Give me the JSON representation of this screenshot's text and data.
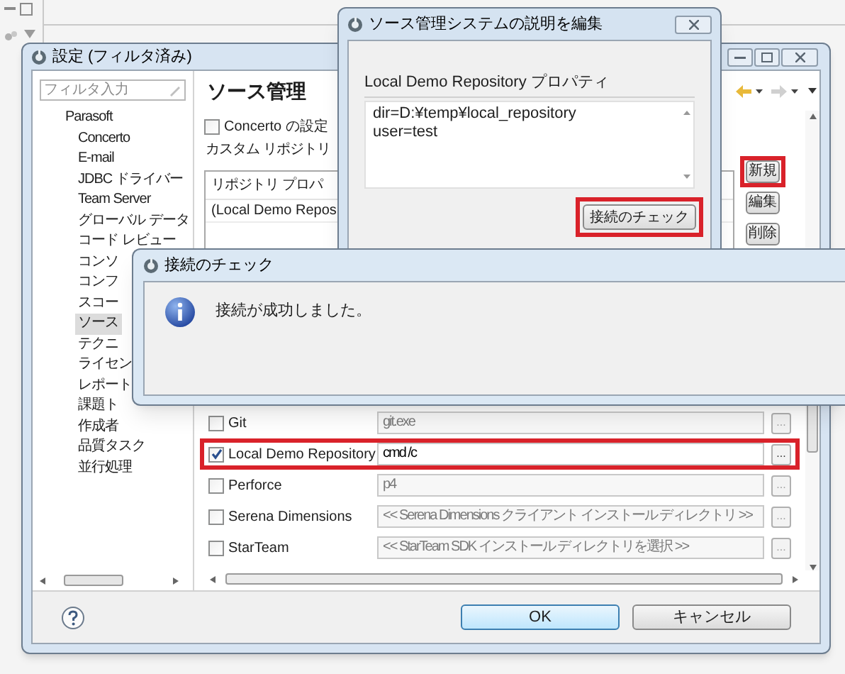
{
  "preferences": {
    "title": "設定 (フィルタ済み)",
    "filter_placeholder": "フィルタ入力",
    "tree": [
      {
        "label": "Parasoft",
        "selected": false,
        "children": [
          {
            "label": "Concerto",
            "selected": false
          },
          {
            "label": "E-mail",
            "selected": false
          },
          {
            "label": "JDBC ドライバー",
            "selected": false
          },
          {
            "label": "Team Server",
            "selected": false
          },
          {
            "label": "グローバル データ",
            "selected": false
          },
          {
            "label": "コード レビュー",
            "selected": false
          },
          {
            "label": "コンソ",
            "selected": false
          },
          {
            "label": "コンフ",
            "selected": false
          },
          {
            "label": "スコー",
            "selected": false
          },
          {
            "label": "ソース",
            "selected": true
          },
          {
            "label": "テクニ",
            "selected": false
          },
          {
            "label": "ライセン",
            "selected": false
          },
          {
            "label": "レポート",
            "selected": false
          },
          {
            "label": "課題ト",
            "selected": false
          },
          {
            "label": "作成者",
            "selected": false
          },
          {
            "label": "品質タスク",
            "selected": false
          },
          {
            "label": "並行処理",
            "selected": false
          }
        ]
      }
    ],
    "page_title": "ソース管理",
    "use_concerto": {
      "label": "Concerto の設定",
      "checked": false
    },
    "custom_repositories_label": "カスタム リポジトリ",
    "repo_table": {
      "columns": [
        "リポジトリ プロパ"
      ],
      "rows": [
        "(Local Demo Repos"
      ]
    },
    "repo_buttons": [
      {
        "label": "新規",
        "highlighted": true
      },
      {
        "label": "編集",
        "highlighted": false
      },
      {
        "label": "削除",
        "highlighted": false
      }
    ],
    "scm_rows": [
      {
        "label": "Git",
        "checked": false,
        "value": "git.exe",
        "highlighted": false
      },
      {
        "label": "Local Demo Repository",
        "checked": true,
        "value": "cmd /c",
        "highlighted": true
      },
      {
        "label": "Perforce",
        "checked": false,
        "value": "p4",
        "highlighted": false
      },
      {
        "label": "Serena Dimensions",
        "checked": false,
        "value": "<< Serena Dimensions クライアント インストール ディレクトリ >>",
        "highlighted": false
      },
      {
        "label": "StarTeam",
        "checked": false,
        "value": "<< StarTeam SDK インストール ディレクトリを選択 >>",
        "highlighted": false
      }
    ],
    "browse_label": "...",
    "buttons": [
      {
        "label": "OK",
        "default": true
      },
      {
        "label": "キャンセル",
        "default": false
      }
    ]
  },
  "edit_dialog": {
    "title": "ソース管理システムの説明を編集",
    "group_label": "Local Demo Repository プロパティ",
    "properties": [
      "dir=D:¥temp¥local_repository",
      "user=test"
    ],
    "check_button": {
      "label": "接続のチェック",
      "highlighted": true
    }
  },
  "check_dialog": {
    "title": "接続のチェック",
    "message": "接続が成功しました。"
  }
}
